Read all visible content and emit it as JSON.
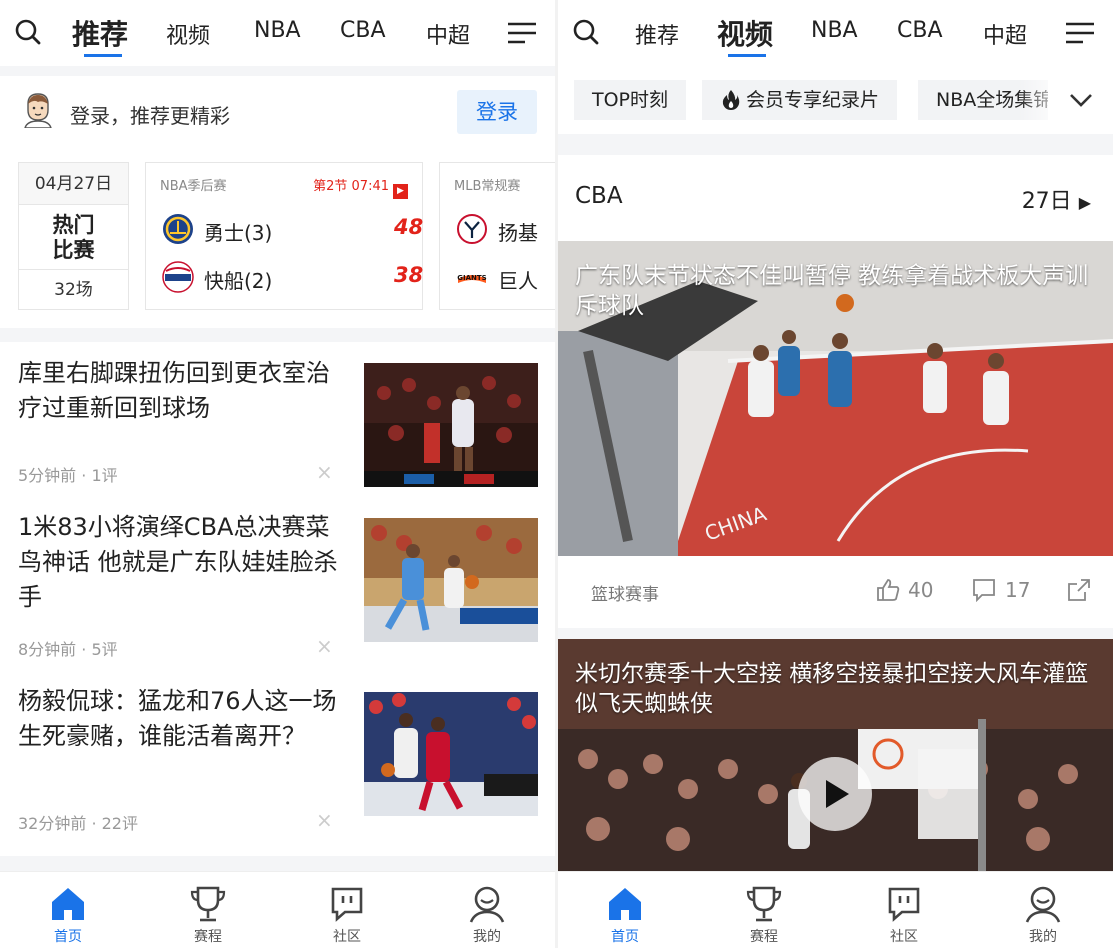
{
  "left": {
    "nav": {
      "tabs": [
        "推荐",
        "视频",
        "NBA",
        "CBA",
        "中超"
      ],
      "active": "推荐"
    },
    "login": {
      "text": "登录，推荐更精彩",
      "button": "登录"
    },
    "date_card": {
      "date": "04月27日",
      "hot_line1": "热门",
      "hot_line2": "比赛",
      "count": "32场"
    },
    "games": [
      {
        "league": "NBA季后赛",
        "status": "第2节 07:41",
        "home": "勇士(3)",
        "home_score": "48",
        "away": "快船(2)",
        "away_score": "38"
      },
      {
        "league": "MLB常规赛",
        "home": "扬基",
        "away": "巨人"
      }
    ],
    "news": [
      {
        "title": "库里右脚踝扭伤回到更衣室治疗过重新回到球场",
        "meta": "5分钟前 · 1评"
      },
      {
        "title": "1米83小将演绎CBA总决赛菜鸟神话 他就是广东队娃娃脸杀手",
        "meta": "8分钟前 · 5评"
      },
      {
        "title": "杨毅侃球：猛龙和76人这一场生死豪赌，谁能活着离开？",
        "meta": "32分钟前 · 22评"
      }
    ],
    "close_glyph": "×"
  },
  "right": {
    "nav": {
      "tabs": [
        "推荐",
        "视频",
        "NBA",
        "CBA",
        "中超"
      ],
      "active": "视频"
    },
    "chips": [
      "TOP时刻",
      "会员专享纪录片",
      "NBA全场集锦"
    ],
    "section": {
      "title": "CBA",
      "date": "27日"
    },
    "videos": [
      {
        "title": "广东队末节状态不佳叫暂停 教练拿着战术板大声训斥球队",
        "source": "篮球赛事",
        "likes": "40",
        "comments": "17"
      },
      {
        "title": "米切尔赛季十大空接 横移空接暴扣空接大风车灌篮似飞天蜘蛛侠"
      }
    ]
  },
  "bottom_nav": [
    {
      "label": "首页",
      "icon": "home-icon",
      "active": true
    },
    {
      "label": "赛程",
      "icon": "trophy-icon",
      "active": false
    },
    {
      "label": "社区",
      "icon": "community-icon",
      "active": false
    },
    {
      "label": "我的",
      "icon": "profile-icon",
      "active": false
    }
  ],
  "colors": {
    "accent": "#1a73e8",
    "live_red": "#e2231a",
    "court_red": "#c9453a"
  }
}
